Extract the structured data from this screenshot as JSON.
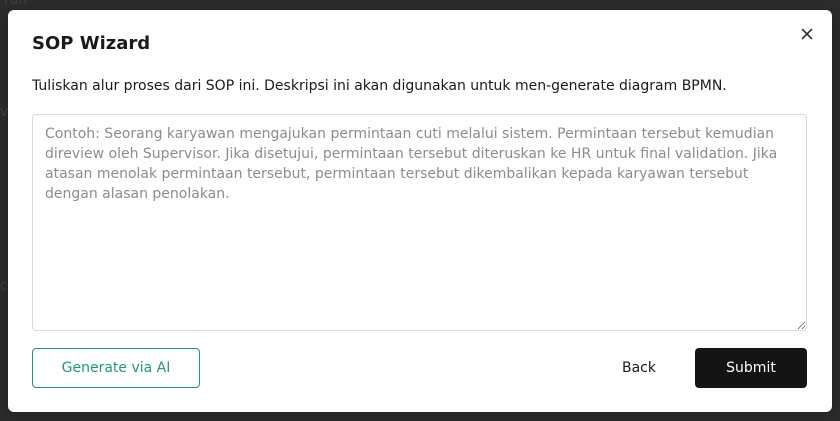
{
  "modal": {
    "title": "SOP Wizard",
    "description": "Tuliskan alur proses dari SOP ini. Deskripsi ini akan digunakan untuk men-generate diagram BPMN.",
    "textarea": {
      "value": "",
      "placeholder": "Contoh: Seorang karyawan mengajukan permintaan cuti melalui sistem. Permintaan tersebut kemudian direview oleh Supervisor. Jika disetujui, permintaan tersebut diteruskan ke HR untuk final validation. Jika atasan menolak permintaan tersebut, permintaan tersebut dikembalikan kepada karyawan tersebut dengan alasan penolakan."
    },
    "buttons": {
      "generate_label": "Generate via AI",
      "back_label": "Back",
      "submit_label": "Submit"
    },
    "close_icon": "close-icon"
  },
  "colors": {
    "accent": "#1f9a7a",
    "primary_button": "#141414",
    "overlay": "#3a3a3a"
  }
}
